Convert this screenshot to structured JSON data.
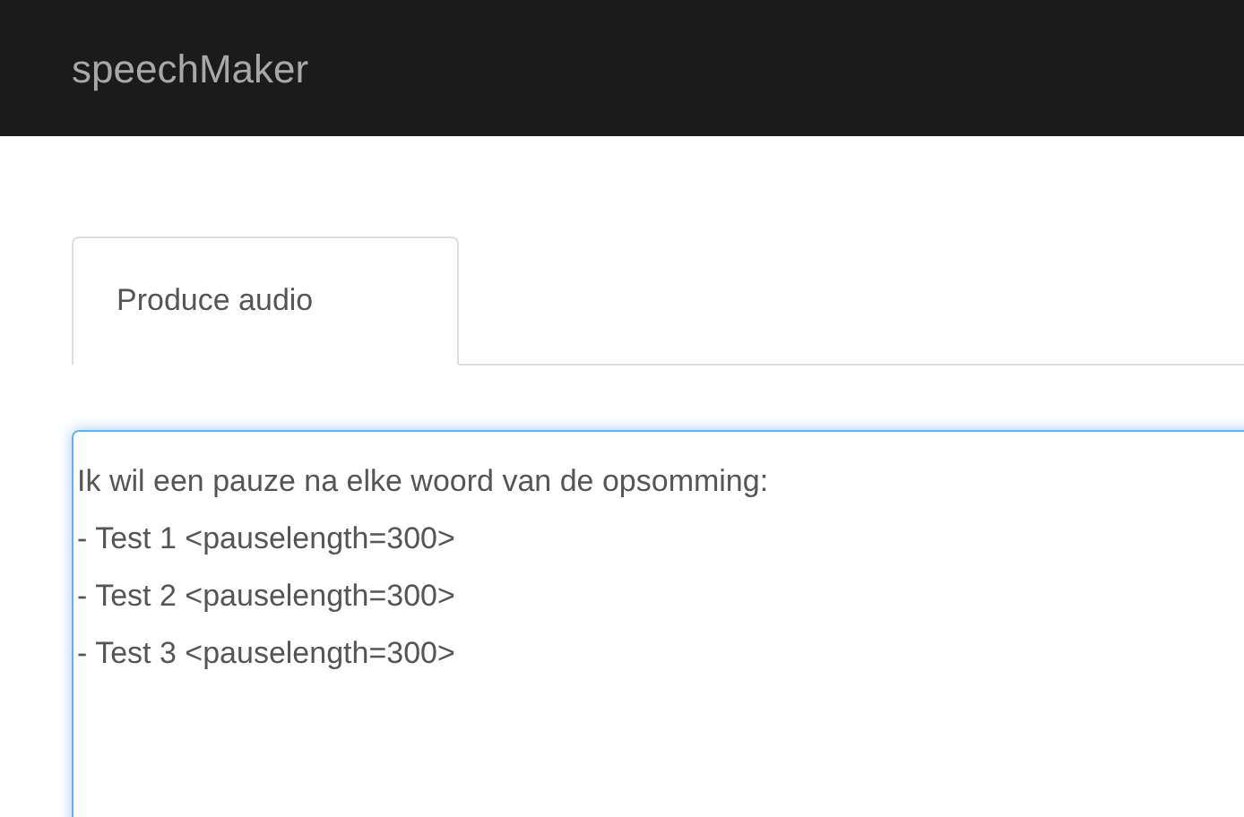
{
  "navbar": {
    "brand": "speechMaker"
  },
  "tabs": [
    {
      "label": "Produce audio",
      "selected": true
    }
  ],
  "editor": {
    "value": "Ik wil een pauze na elke woord van de opsomming:\n- Test 1 <pauselength=300>\n- Test 2 <pauselength=300>\n- Test 3 <pauselength=300>"
  }
}
